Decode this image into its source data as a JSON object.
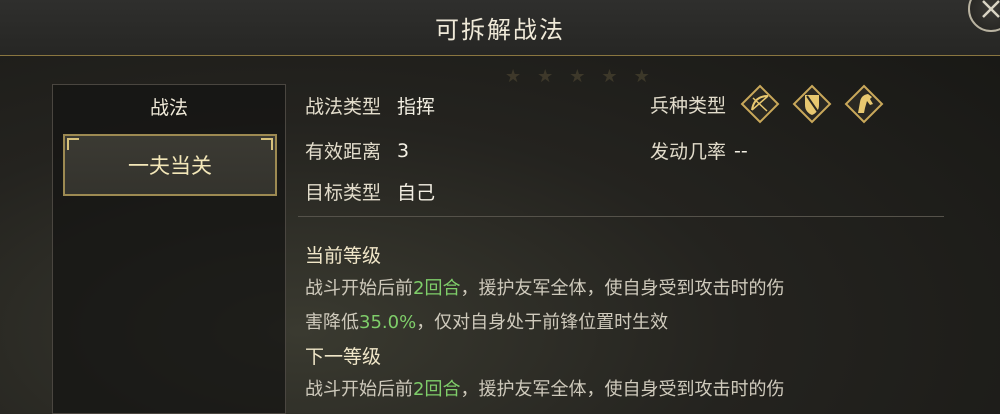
{
  "window": {
    "title": "可拆解战法"
  },
  "left_panel": {
    "header": "战法",
    "selected_item": "一夫当关"
  },
  "info": {
    "type_label": "战法类型",
    "type_value": "指挥",
    "range_label": "有效距离",
    "range_value": "3",
    "target_label": "目标类型",
    "target_value": "自己",
    "troop_label": "兵种类型",
    "rate_label": "发动几率",
    "rate_value": "--",
    "troop_icons": [
      "archer-bow-icon",
      "shield-infantry-icon",
      "cavalry-horse-icon"
    ]
  },
  "current_level": {
    "title": "当前等级",
    "line1_a": "战斗开始后前",
    "line1_hl": "2回合",
    "line1_b": "，援护友军全体，使自身受到攻击时的伤",
    "line2_a": "害降低",
    "line2_hl": "35.0%",
    "line2_b": "，仅对自身处于前锋位置时生效"
  },
  "next_level": {
    "title": "下一等级",
    "line1_a": "战斗开始后前",
    "line1_hl": "2回合",
    "line1_b": "，援护友军全体，使自身受到攻击时的伤"
  },
  "colors": {
    "accent_gold": "#9d8a52",
    "highlight_green": "#7fce6a"
  }
}
